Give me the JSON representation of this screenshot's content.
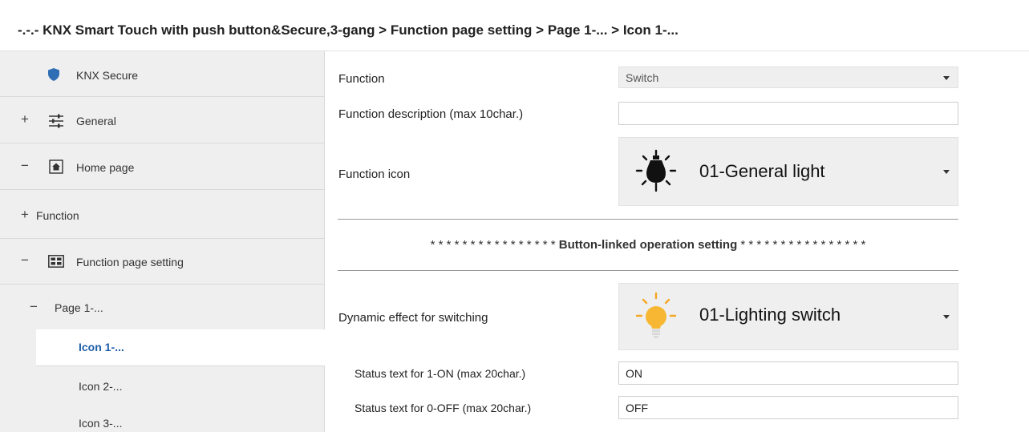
{
  "breadcrumb": "-.-.- KNX Smart Touch with push button&Secure,3-gang > Function page setting > Page 1-... > Icon 1-...",
  "sidebar": {
    "items": [
      {
        "label": "KNX Secure",
        "prefix": ""
      },
      {
        "label": "General",
        "prefix": "+"
      },
      {
        "label": "Home page",
        "prefix": "−"
      },
      {
        "label": "Function",
        "prefix": "+"
      },
      {
        "label": "Function page setting",
        "prefix": "−"
      },
      {
        "label": "Page 1-...",
        "prefix": "−"
      },
      {
        "label": "Icon 1-...",
        "prefix": ""
      },
      {
        "label": "Icon 2-...",
        "prefix": ""
      },
      {
        "label": "Icon 3-...",
        "prefix": ""
      }
    ]
  },
  "main": {
    "function": {
      "label": "Function",
      "value": "Switch"
    },
    "description": {
      "label": "Function description (max 10char.)",
      "value": ""
    },
    "icon": {
      "label": "Function icon",
      "value": "01-General light"
    },
    "section_title": {
      "stars_left": "* * * * * * * * * * * * * * * *",
      "text": "Button-linked operation setting",
      "stars_right": "* * * * * * * * * * * * * * * *"
    },
    "dynamic": {
      "label": "Dynamic effect for switching",
      "value": "01-Lighting switch"
    },
    "status_on": {
      "label": "Status text for 1-ON (max 20char.)",
      "value": "ON"
    },
    "status_off": {
      "label": "Status text for 0-OFF (max 20char.)",
      "value": "OFF"
    }
  },
  "colors": {
    "accent": "#1f5fa8",
    "shield": "#2f6db5",
    "bulb": "#f5a623"
  }
}
